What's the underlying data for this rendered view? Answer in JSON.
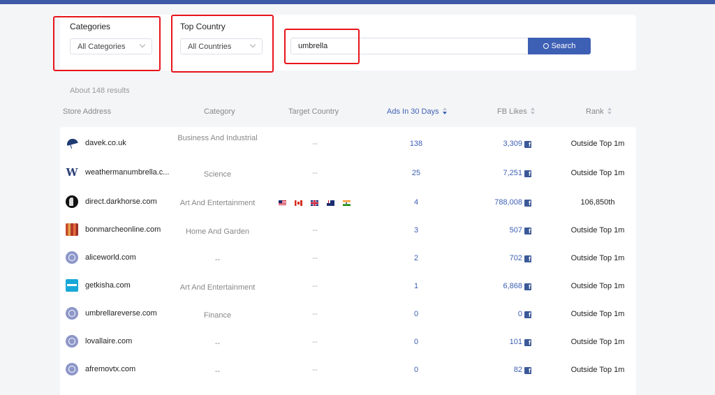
{
  "filters": {
    "categories": {
      "label": "Categories",
      "value": "All Categories"
    },
    "top_country": {
      "label": "Top Country",
      "value": "All Countries"
    },
    "search": {
      "value": "umbrella",
      "button_label": "Search"
    }
  },
  "results_text": "About 148 results",
  "columns": {
    "store_address": "Store Address",
    "category": "Category",
    "target_country": "Target Country",
    "ads_in_30_days": "Ads In 30 Days",
    "fb_likes": "FB Likes",
    "rank": "Rank"
  },
  "rows": [
    {
      "store": "davek.co.uk",
      "logo": "umbrella-logo-icon",
      "category": "Business And Industrial",
      "target_country": "--",
      "ads": "138",
      "likes": "3,309",
      "rank": "Outside Top 1m"
    },
    {
      "store": "weathermanumbrella.c...",
      "logo": "w-logo-icon",
      "category": "Science",
      "target_country": "--",
      "ads": "25",
      "likes": "7,251",
      "rank": "Outside Top 1m"
    },
    {
      "store": "direct.darkhorse.com",
      "logo": "horse-logo-icon",
      "category": "Art And Entertainment",
      "flags": [
        "us-flag-icon",
        "canada-flag-icon",
        "uk-flag-icon",
        "australia-flag-icon",
        "india-flag-icon"
      ],
      "ads": "4",
      "likes": "788,008",
      "rank": "106,850th"
    },
    {
      "store": "bonmarcheonline.com",
      "logo": "stripes-logo-icon",
      "category": "Home And Garden",
      "target_country": "--",
      "ads": "3",
      "likes": "507",
      "rank": "Outside Top 1m"
    },
    {
      "store": "aliceworld.com",
      "logo": "globe-icon",
      "category": "--",
      "target_country": "--",
      "ads": "2",
      "likes": "702",
      "rank": "Outside Top 1m"
    },
    {
      "store": "getkisha.com",
      "logo": "kisha-logo-icon",
      "category": "Art And Entertainment",
      "target_country": "--",
      "ads": "1",
      "likes": "6,868",
      "rank": "Outside Top 1m"
    },
    {
      "store": "umbrellareverse.com",
      "logo": "globe-icon",
      "category": "Finance",
      "target_country": "--",
      "ads": "0",
      "likes": "0",
      "rank": "Outside Top 1m"
    },
    {
      "store": "lovallaire.com",
      "logo": "globe-icon",
      "category": "--",
      "target_country": "--",
      "ads": "0",
      "likes": "101",
      "rank": "Outside Top 1m"
    },
    {
      "store": "afremovtx.com",
      "logo": "globe-icon",
      "category": "--",
      "target_country": "--",
      "ads": "0",
      "likes": "82",
      "rank": "Outside Top 1m"
    }
  ],
  "colors": {
    "accent": "#3e60b4",
    "highlight": "#e8141a",
    "facebook": "#3b5998"
  }
}
